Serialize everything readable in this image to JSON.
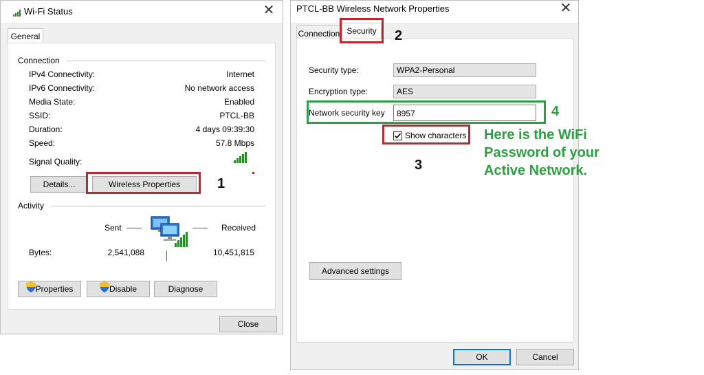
{
  "wifi_status": {
    "title": "Wi-Fi Status",
    "tab_general": "General",
    "section_connection": "Connection",
    "rows": [
      {
        "label": "IPv4 Connectivity:",
        "value": "Internet"
      },
      {
        "label": "IPv6 Connectivity:",
        "value": "No network access"
      },
      {
        "label": "Media State:",
        "value": "Enabled"
      },
      {
        "label": "SSID:",
        "value": "PTCL-BB"
      },
      {
        "label": "Duration:",
        "value": "4 days 09:39:30"
      },
      {
        "label": "Speed:",
        "value": "57.8 Mbps"
      }
    ],
    "signal_quality_label": "Signal Quality:",
    "details_button": "Details...",
    "wireless_properties_button": "Wireless Properties",
    "section_activity": "Activity",
    "sent_label": "Sent",
    "received_label": "Received",
    "bytes_label": "Bytes:",
    "bytes_sent": "2,541,088",
    "bytes_received": "10,451,815",
    "properties_button": "Properties",
    "disable_button": "Disable",
    "diagnose_button": "Diagnose",
    "close_button": "Close"
  },
  "props": {
    "title": "PTCL-BB Wireless Network Properties",
    "tab_connection": "Connection",
    "tab_security": "Security",
    "security_type_label": "Security type:",
    "security_type_value": "WPA2-Personal",
    "encryption_type_label": "Encryption type:",
    "encryption_type_value": "AES",
    "network_key_label": "Network security key",
    "network_key_value": "8957",
    "show_characters_label": "Show characters",
    "advanced_settings_button": "Advanced settings",
    "ok_button": "OK",
    "cancel_button": "Cancel"
  },
  "annotations": {
    "step1": "1",
    "step2": "2",
    "step3": "3",
    "step4": "4",
    "callout_line1": "Here is the WiFi",
    "callout_line2": "Password of your",
    "callout_line3": "Active Network.",
    "highlight_red": "#c0272d",
    "highlight_green": "#2d9e43"
  },
  "icons": [
    "wifi-signal-icon",
    "close-icon",
    "chevron-down-icon",
    "network-computers-icon",
    "shield-icon",
    "checkbox-checked-icon"
  ]
}
